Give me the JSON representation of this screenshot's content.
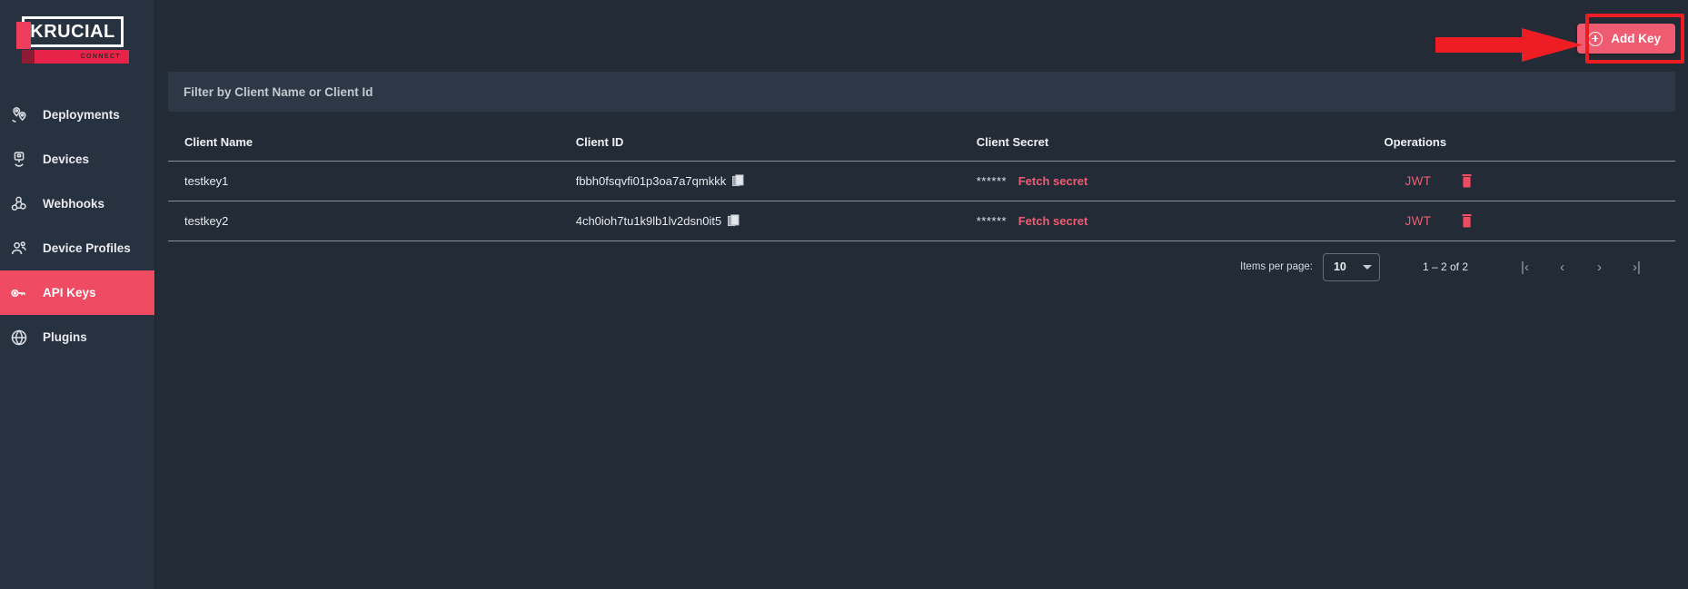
{
  "brand": {
    "name": "KRUCIAL",
    "sub": "CONNECT"
  },
  "sidebar": {
    "items": [
      {
        "label": "Deployments",
        "icon": "location-pins-icon",
        "active": false
      },
      {
        "label": "Devices",
        "icon": "device-icon",
        "active": false
      },
      {
        "label": "Webhooks",
        "icon": "webhook-icon",
        "active": false
      },
      {
        "label": "Device Profiles",
        "icon": "users-icon",
        "active": false
      },
      {
        "label": "API Keys",
        "icon": "key-icon",
        "active": true
      },
      {
        "label": "Plugins",
        "icon": "globe-icon",
        "active": false
      }
    ]
  },
  "toolbar": {
    "add_key_label": "Add Key",
    "add_key_icon": "plus-circle-icon"
  },
  "filter": {
    "placeholder": "Filter by Client Name or Client Id",
    "value": ""
  },
  "table": {
    "columns": [
      "Client Name",
      "Client ID",
      "Client Secret",
      "Operations"
    ],
    "rows": [
      {
        "client_name": "testkey1",
        "client_id": "fbbh0fsqvfi01p3oa7a7qmkkk",
        "secret_mask": "******",
        "fetch_secret_label": "Fetch secret",
        "jwt_label": "JWT",
        "copy_icon": "copy-icon",
        "delete_icon": "trash-icon"
      },
      {
        "client_name": "testkey2",
        "client_id": "4ch0ioh7tu1k9lb1lv2dsn0it5",
        "secret_mask": "******",
        "fetch_secret_label": "Fetch secret",
        "jwt_label": "JWT",
        "copy_icon": "copy-icon",
        "delete_icon": "trash-icon"
      }
    ]
  },
  "paginator": {
    "items_per_page_label": "Items per page:",
    "items_per_page_value": "10",
    "range_label": "1 – 2 of 2",
    "first_page_glyph": "|‹",
    "prev_page_glyph": "‹",
    "next_page_glyph": "›",
    "last_page_glyph": "›|"
  },
  "annotation": {
    "highlight_color": "#ee1d23",
    "arrow_name": "red-pointer-arrow",
    "box_name": "red-highlight-box"
  },
  "colors": {
    "accent": "#ef5c72",
    "sidebar_bg": "#273240",
    "page_bg": "#222b36",
    "filter_bg": "#2c3846"
  }
}
